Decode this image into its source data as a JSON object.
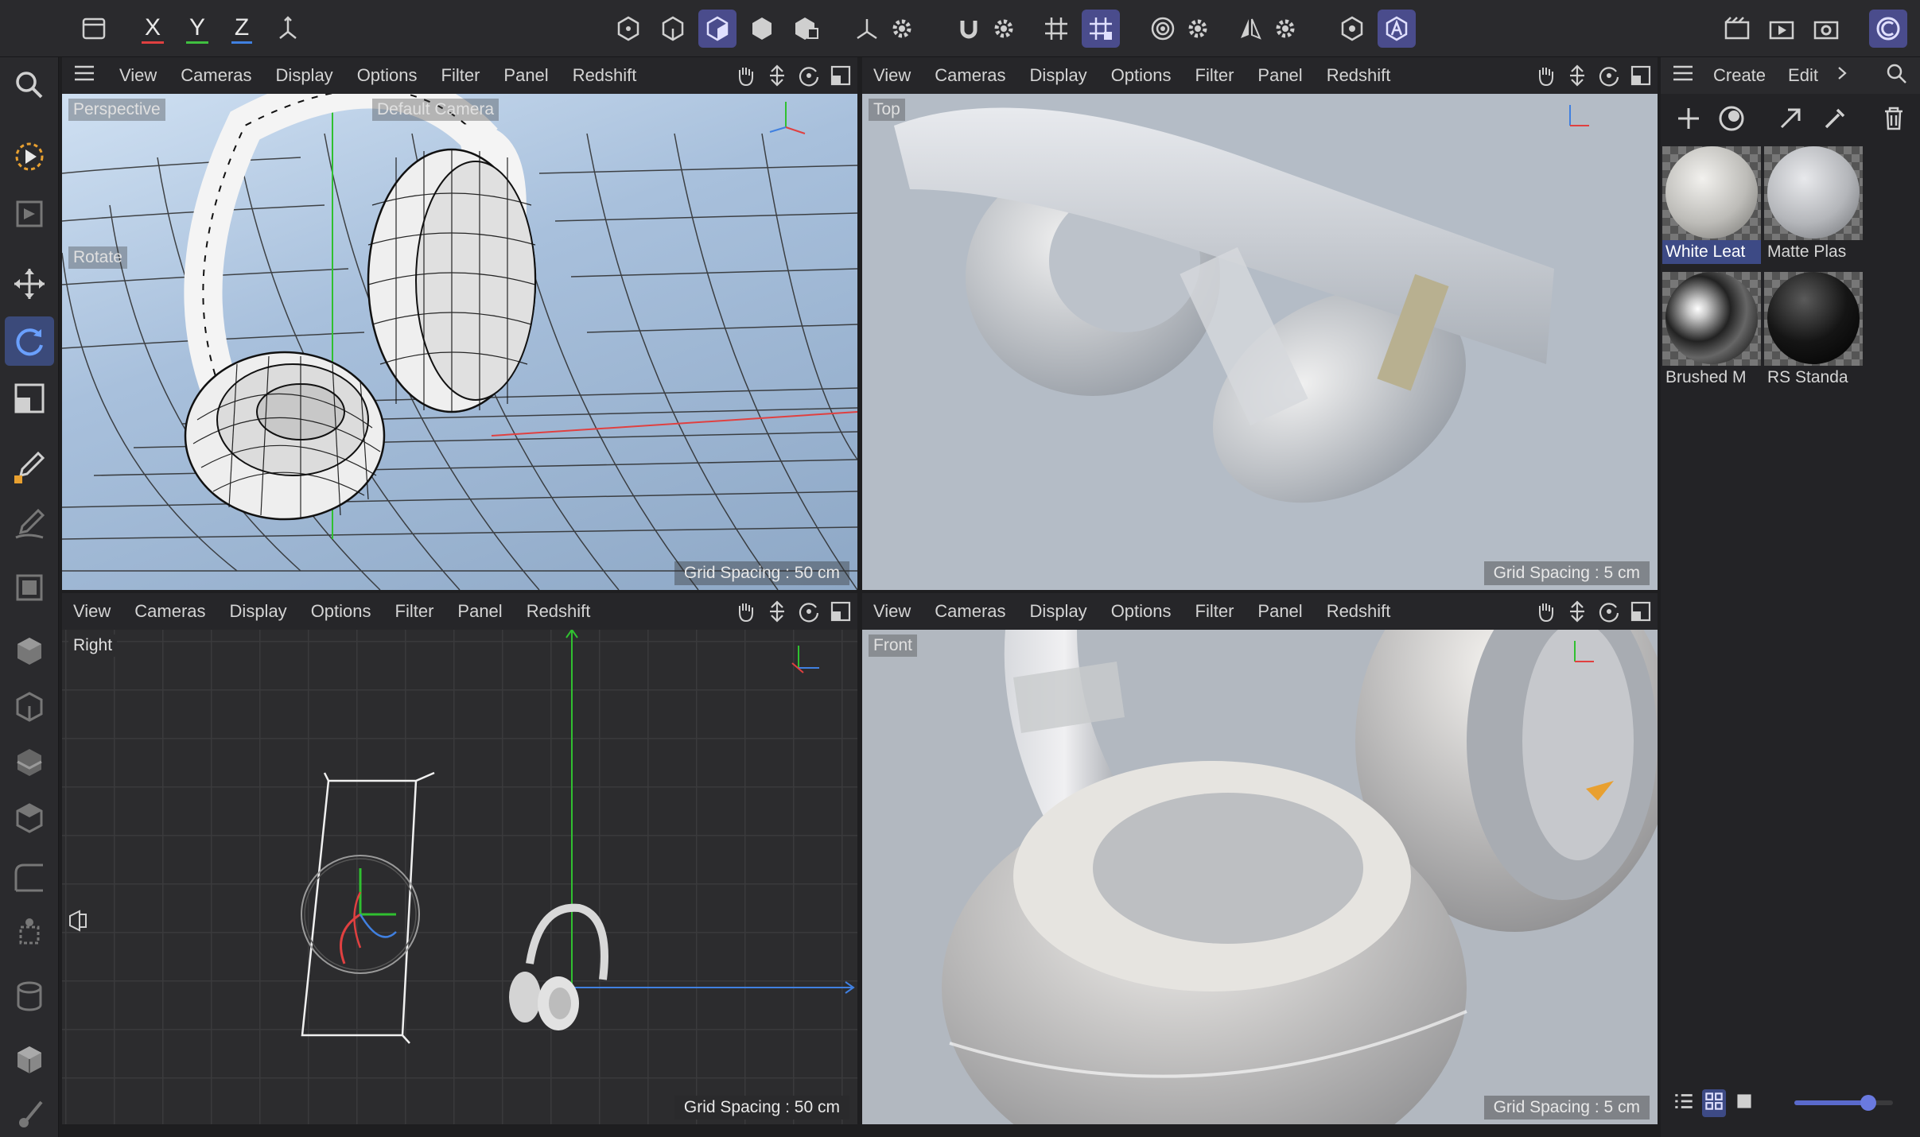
{
  "colors": {
    "accent": "#4a4c8c",
    "axis_x": "#e04040",
    "axis_y": "#40c040",
    "axis_z": "#4080e0"
  },
  "top_toolbar": {
    "axis_x": "X",
    "axis_y": "Y",
    "axis_z": "Z"
  },
  "viewports": {
    "perspective": {
      "menu": [
        "View",
        "Cameras",
        "Display",
        "Options",
        "Filter",
        "Panel",
        "Redshift"
      ],
      "label": "Perspective",
      "camera_label": "Default Camera",
      "mode_label": "Rotate",
      "grid": "Grid Spacing : 50 cm"
    },
    "top": {
      "menu": [
        "View",
        "Cameras",
        "Display",
        "Options",
        "Filter",
        "Panel",
        "Redshift"
      ],
      "label": "Top",
      "grid": "Grid Spacing : 5 cm"
    },
    "right": {
      "menu": [
        "View",
        "Cameras",
        "Display",
        "Options",
        "Filter",
        "Panel",
        "Redshift"
      ],
      "label": "Right",
      "grid": "Grid Spacing : 50 cm"
    },
    "front": {
      "menu": [
        "View",
        "Cameras",
        "Display",
        "Options",
        "Filter",
        "Panel",
        "Redshift"
      ],
      "label": "Front",
      "grid": "Grid Spacing : 5 cm"
    }
  },
  "materials_panel": {
    "menu": [
      "Create",
      "Edit"
    ],
    "materials": [
      {
        "name": "White Leat",
        "selected": true
      },
      {
        "name": "Matte Plas",
        "selected": false
      },
      {
        "name": "Brushed M",
        "selected": false
      },
      {
        "name": "RS Standa",
        "selected": false
      }
    ],
    "zoom_slider": 0.75
  }
}
